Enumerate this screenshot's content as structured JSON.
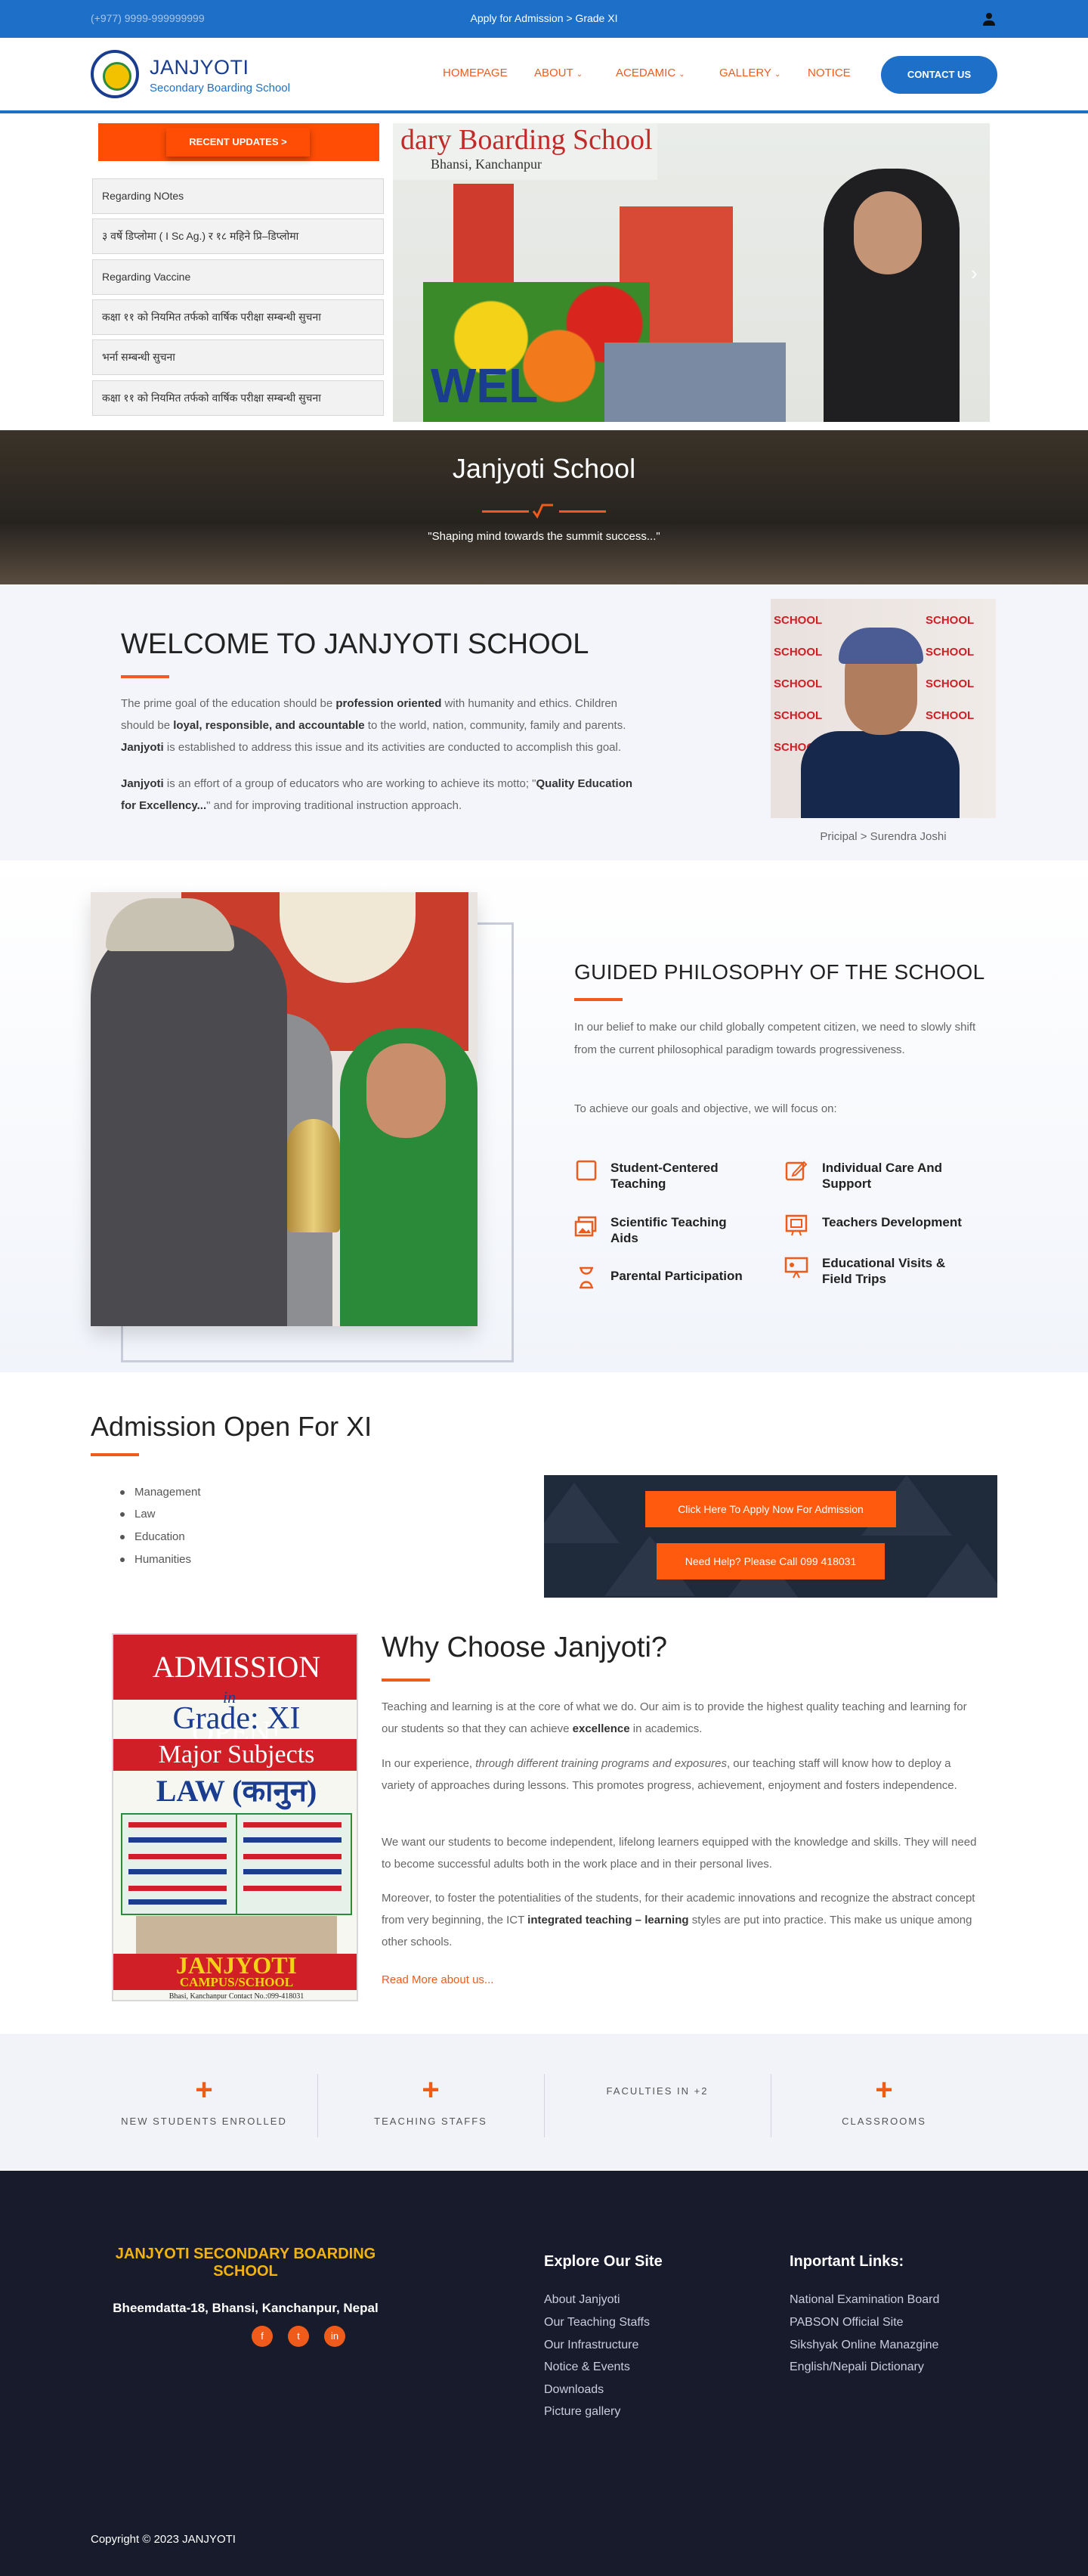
{
  "topbar": {
    "phone": "(+977) 9999-999999999",
    "admission_link": "Apply for Admission > Grade XI"
  },
  "header": {
    "brand": "JANJYOTI",
    "tagline": "Secondary Boarding School",
    "nav": [
      "HOMEPAGE",
      "ABOUT",
      "ACEDAMIC",
      "GALLERY",
      "NOTICE"
    ],
    "contact": "CONTACT US"
  },
  "updates": {
    "button": "RECENT UPDATES >",
    "items": [
      "Regarding NOtes",
      "३ वर्षे डिप्लोमा ( I Sc Ag.) र १८ महिने प्रि–डिप्लोमा",
      "Regarding Vaccine",
      "कक्षा ११ को नियमित तर्फको वार्षिक परीक्षा सम्बन्धी सुचना",
      "भर्ना सम्बन्धी सुचना",
      "कक्षा ११ को नियमित तर्फको वार्षिक परीक्षा सम्बन्धी सुचना"
    ]
  },
  "slider": {
    "banner": "dary Boarding School",
    "banner_sub": "Bhansi, Kanchanpur",
    "banner_bottom": "WEL"
  },
  "hero": {
    "title": "Janjyoti School",
    "quote": "\"Shaping mind towards the summit success...\""
  },
  "welcome": {
    "title": "WELCOME TO JANJYOTI SCHOOL",
    "p1_a": "The prime goal of the education should be ",
    "p1_b": "profession oriented",
    "p1_c": " with humanity and ethics. Children",
    "p1_d": "should be ",
    "p1_e": "loyal, responsible, and accountable",
    "p1_f": " to the world, nation, community, family and parents.",
    "p1_g": "Janjyoti",
    "p1_h": " is established to address this issue and its activities are conducted to accomplish this goal.",
    "p2_a": "Janjyoti",
    "p2_b": " is an effort of a group of educators who are working to achieve its motto; \"",
    "p2_c": "Quality Education",
    "p2_d": "for Excellency...",
    "p2_e": "\" and for improving traditional instruction approach.",
    "principal_caption": "Pricipal > Surendra Joshi",
    "bg_label": "SCHOOL"
  },
  "philosophy": {
    "title": "GUIDED PHILOSOPHY OF THE SCHOOL",
    "p1": "In our belief to make our child globally competent citizen, we need to slowly shift from the current  philosophical  paradigm  towards progressiveness.",
    "p2": "To achieve our goals and objective, we will focus on:",
    "features": [
      {
        "label": "Student-Centered Teaching",
        "icon": "square-icon"
      },
      {
        "label": "Individual Care And Support",
        "icon": "edit-icon"
      },
      {
        "label": "Scientific Teaching Aids",
        "icon": "image-icon"
      },
      {
        "label": "Teachers Development",
        "icon": "presentation-icon"
      },
      {
        "label": "Parental Participation",
        "icon": "hourglass-icon"
      },
      {
        "label": "Educational Visits & Field Trips",
        "icon": "projector-icon"
      }
    ]
  },
  "admission": {
    "title": "Admission Open For XI",
    "streams": [
      "Management",
      "Law",
      "Education",
      "Humanities"
    ],
    "apply_btn": "Click Here To Apply Now For Admission",
    "help_btn": "Need Help? Please Call 099 418031"
  },
  "poster": {
    "line1": "ADMISSION OPEN!",
    "line_in": "in",
    "line2": "Grade: XI",
    "line3": "Major Subjects",
    "line4": "LAW (कानुन)",
    "line5": "JANJYOTI",
    "line6": "CAMPUS/SCHOOL",
    "footer": "Bhasi, Kanchanpur          Contact No.:099-418031"
  },
  "why": {
    "title": "Why Choose Janjyoti?",
    "p1_a": "Teaching and learning is at the core of what we do. Our aim is to provide the highest quality teaching and learning for our students so that they can achieve ",
    "p1_b": "excellence",
    "p1_c": " in academics.",
    "p2_a": "In our experience, ",
    "p2_b": "through different training programs and exposures",
    "p2_c": ", our teaching staff will know how to deploy a variety of approaches during lessons. This promotes progress, achievement, enjoyment and fosters independence.",
    "p3": "We want our students to become independent, lifelong learners equipped with the knowledge and skills. They will need to become successful adults both in the work place and in their personal lives.",
    "p4_a": "Moreover, to foster the potentialities of the students, for their academic innovations and recognize the abstract concept from very beginning, the ICT ",
    "p4_b": "integrated teaching – learning",
    "p4_c": " styles are put into practice. This make us unique among other schools.",
    "read_more": "Read More about us..."
  },
  "stats": [
    {
      "value": "+",
      "label": "NEW STUDENTS ENROLLED"
    },
    {
      "value": "+",
      "label": "TEACHING STAFFS"
    },
    {
      "value": "",
      "label": "FACULTIES IN +2"
    },
    {
      "value": "+",
      "label": "CLASSROOMS"
    }
  ],
  "footer": {
    "school": "JANJYOTI SECONDARY BOARDING SCHOOL",
    "address": "Bheemdatta-18, Bhansi, Kanchanpur, Nepal",
    "social": [
      "facebook-icon",
      "twitter-icon",
      "linkedin-icon"
    ],
    "explore_title": "Explore Our Site",
    "explore": [
      "About Janjyoti",
      "Our Teaching Staffs",
      "Our Infrastructure",
      "Notice & Events",
      "Downloads",
      "Picture gallery"
    ],
    "links_title": "Inportant Links:",
    "links": [
      "National Examination Board",
      "PABSON Official Site",
      "Sikshyak Online Manazgine",
      "English/Nepali Dictionary"
    ],
    "copyright": "Copyright © 2023 JANJYOTI"
  },
  "colors": {
    "primary": "#1e6fc8",
    "accent": "#ef5b1b",
    "footer_bg": "#171b2b",
    "gold": "#f2b30f"
  }
}
